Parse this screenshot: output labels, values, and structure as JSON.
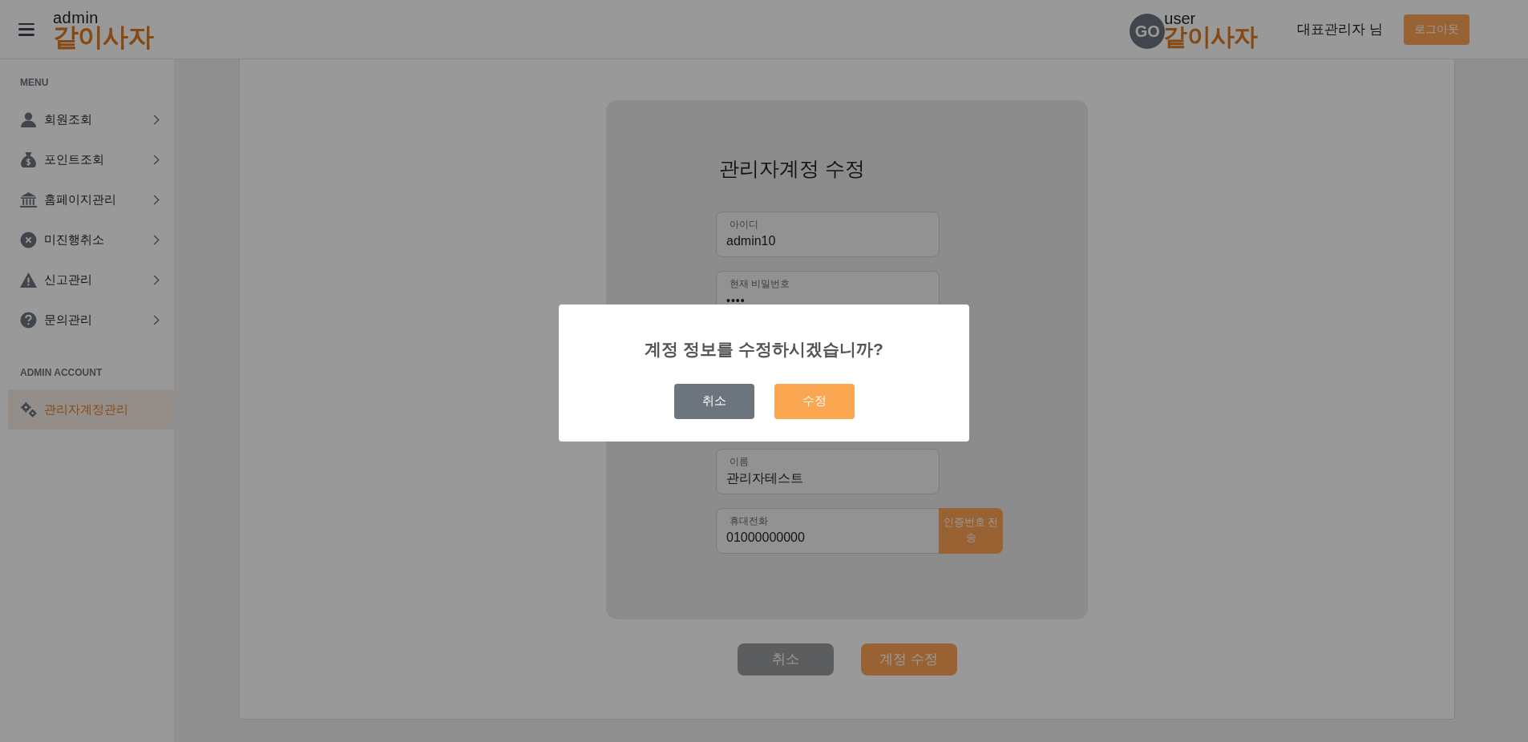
{
  "header": {
    "admin_logo": {
      "small": "admin",
      "main": "같이사자"
    },
    "user_logo": {
      "badge": "GO",
      "small": "user",
      "main": "같이사자"
    },
    "user_name": "대표관리자 님",
    "logout_button": "로그아웃"
  },
  "sidebar": {
    "sections": [
      {
        "heading": "MENU",
        "items": [
          {
            "label": "회원조회",
            "selected": false,
            "chevron": true
          },
          {
            "label": "포인트조회",
            "selected": false,
            "chevron": true
          },
          {
            "label": "홈페이지관리",
            "selected": false,
            "chevron": true
          },
          {
            "label": "미진행취소",
            "selected": false,
            "chevron": true
          },
          {
            "label": "신고관리",
            "selected": false,
            "chevron": true
          },
          {
            "label": "문의관리",
            "selected": false,
            "chevron": true
          }
        ]
      },
      {
        "heading": "ADMIN ACCOUNT",
        "items": [
          {
            "label": "관리자계정관리",
            "selected": true,
            "chevron": false
          }
        ]
      }
    ]
  },
  "form": {
    "title": "관리자계정 수정",
    "fields": [
      {
        "kind": "text",
        "label": "아이디",
        "value": "admin10"
      },
      {
        "kind": "password",
        "label": "현재 비밀번호",
        "value": "••••"
      },
      {
        "kind": "text",
        "label": "이름",
        "value": "관리자테스트"
      },
      {
        "kind": "action",
        "label": "휴대전화",
        "value": "01000000000",
        "button": "인증번호 전송"
      }
    ]
  },
  "buttons": [
    {
      "kind": "secondary",
      "label": "취소"
    },
    {
      "kind": "primary",
      "label": "계정 수정"
    }
  ],
  "dialog": {
    "message": "계정 정보를 수정하시겠습니까?",
    "buttons": [
      {
        "kind": "secondary",
        "label": "취소"
      },
      {
        "kind": "primary",
        "label": "수정"
      }
    ]
  }
}
